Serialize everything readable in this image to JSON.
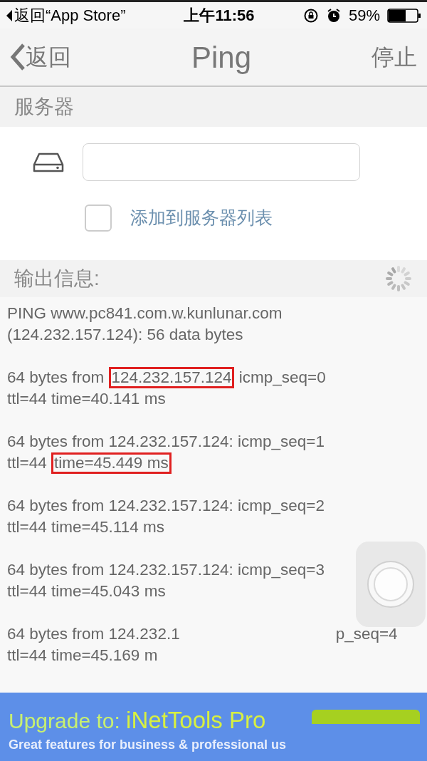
{
  "status_bar": {
    "back_app": "返回“App Store”",
    "time": "上午11:56",
    "battery": "59%"
  },
  "nav": {
    "back": "返回",
    "title": "Ping",
    "action": "停止"
  },
  "server_section": {
    "title": "服务器",
    "add_to_list": {
      "label": "添加到服务器列表",
      "checked": false
    }
  },
  "output_section": {
    "title": "输出信息:",
    "loading": true
  },
  "output": [
    {
      "lines": [
        [
          {
            "text": "PING www.pc841.com.w.kunlunar.com",
            "boxed": false
          }
        ],
        [
          {
            "text": "(124.232.157.124): 56 data bytes",
            "boxed": false
          }
        ]
      ]
    },
    {
      "lines": [
        [
          {
            "text": "64 bytes from ",
            "boxed": false
          },
          {
            "text": "124.232.157.124",
            "boxed": true
          },
          {
            "text": " icmp_seq=0",
            "boxed": false
          }
        ],
        [
          {
            "text": "ttl=44 time=40.141 ms",
            "boxed": false
          }
        ]
      ]
    },
    {
      "lines": [
        [
          {
            "text": "64 bytes from 124.232.157.124: icmp_seq=1",
            "boxed": false
          }
        ],
        [
          {
            "text": "ttl=44 ",
            "boxed": false
          },
          {
            "text": "time=45.449 ms",
            "boxed": true
          }
        ]
      ]
    },
    {
      "lines": [
        [
          {
            "text": "64 bytes from 124.232.157.124: icmp_seq=2",
            "boxed": false
          }
        ],
        [
          {
            "text": "ttl=44 time=45.114 ms",
            "boxed": false
          }
        ]
      ]
    },
    {
      "lines": [
        [
          {
            "text": "64 bytes from 124.232.157.124: icmp_seq=3",
            "boxed": false
          }
        ],
        [
          {
            "text": "ttl=44 time=45.043 ms",
            "boxed": false
          }
        ]
      ]
    },
    {
      "lines": [
        [
          {
            "text": "64 bytes from 124.232.1",
            "boxed": false
          },
          {
            "text": "p_seq=4",
            "boxed": false,
            "kind": "after_gap"
          }
        ],
        [
          {
            "text": "ttl=44 time=45.169 m",
            "boxed": false
          }
        ]
      ]
    }
  ],
  "ad": {
    "headline": "Upgrade to: ",
    "product": "iNetTools Pro",
    "tagline": "Great features for business & professional us"
  }
}
